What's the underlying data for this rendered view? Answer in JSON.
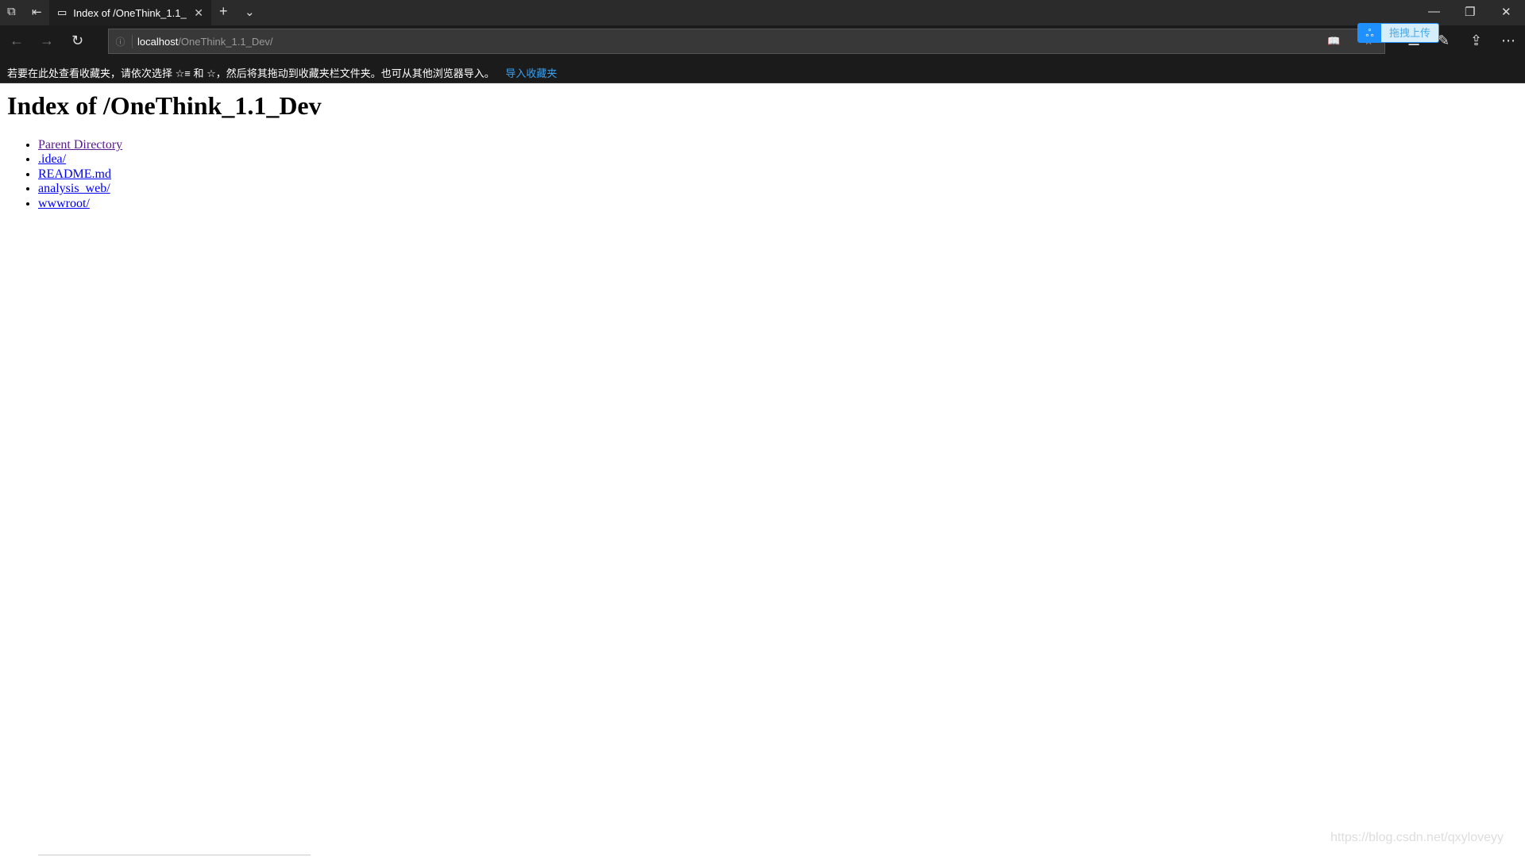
{
  "browser": {
    "tab_title": "Index of /OneThink_1.1_",
    "address_host": "localhost",
    "address_path": "/OneThink_1.1_Dev/",
    "favorites_hint": "若要在此处查看收藏夹，请依次选择 ☆≡ 和 ☆，然后将其拖动到收藏夹栏文件夹。也可从其他浏览器导入。",
    "import_favorites": "导入收藏夹",
    "upload_label": "拖拽上传"
  },
  "page": {
    "title": "Index of /OneThink_1.1_Dev",
    "links": [
      {
        "label": "Parent Directory",
        "visited": true
      },
      {
        "label": ".idea/"
      },
      {
        "label": "README.md"
      },
      {
        "label": "analysis_web/"
      },
      {
        "label": "wwwroot/"
      }
    ]
  },
  "watermark": "https://blog.csdn.net/qxyloveyy"
}
